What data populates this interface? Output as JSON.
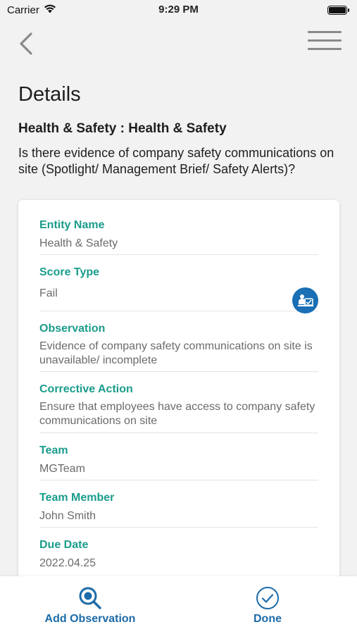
{
  "status_bar": {
    "carrier": "Carrier",
    "time": "9:29 PM"
  },
  "page": {
    "title": "Details",
    "section": "Health & Safety : Health & Safety",
    "question": "Is there evidence of company safety communications on site (Spotlight/ Management Brief/ Safety Alerts)?"
  },
  "fields": {
    "entity_name": {
      "label": "Entity Name",
      "value": "Health & Safety"
    },
    "score_type": {
      "label": "Score Type",
      "value": "Fail"
    },
    "observation": {
      "label": "Observation",
      "value": "Evidence of company safety communications on site is unavailable/ incomplete"
    },
    "corrective_action": {
      "label": "Corrective Action",
      "value": "Ensure that employees have access to company safety communications on site"
    },
    "team": {
      "label": "Team",
      "value": "MGTeam"
    },
    "team_member": {
      "label": "Team Member",
      "value": "John Smith"
    },
    "due_date": {
      "label": "Due Date",
      "value": "2022.04.25"
    }
  },
  "bottom_bar": {
    "add_observation": "Add Observation",
    "done": "Done"
  },
  "colors": {
    "accent_teal": "#1a9c8c",
    "accent_blue": "#1c6ba8"
  },
  "icons": [
    "back-chevron-icon",
    "hamburger-menu-icon",
    "wifi-icon",
    "battery-icon",
    "assign-user-icon",
    "search-icon",
    "checkmark-circle-icon"
  ]
}
